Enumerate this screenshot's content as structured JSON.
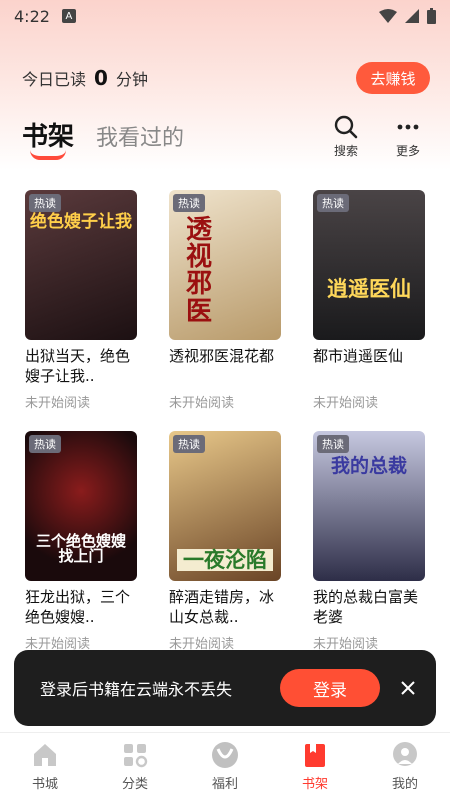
{
  "status_bar": {
    "time": "4:22",
    "notification_letter": "A"
  },
  "reading": {
    "prefix": "今日已读",
    "minutes": "0",
    "suffix": "分钟",
    "earn_label": "去赚钱"
  },
  "tabs": {
    "active": "书架",
    "inactive": "我看过的"
  },
  "actions": {
    "search_label": "搜索",
    "more_label": "更多"
  },
  "books": [
    {
      "title": "出狱当天，绝色嫂子让我..",
      "status": "未开始阅读",
      "badge": "热读",
      "cover_text": "绝色嫂子让我",
      "cover_color": "#3a2426"
    },
    {
      "title": "透视邪医混花都",
      "status": "未开始阅读",
      "badge": "热读",
      "cover_text": "透视邪医",
      "cover_color": "#d9c8a8"
    },
    {
      "title": "都市逍遥医仙",
      "status": "未开始阅读",
      "badge": "热读",
      "cover_text": "逍遥医仙",
      "cover_color": "#2e2a2c"
    },
    {
      "title": "狂龙出狱，三个绝色嫂嫂..",
      "status": "未开始阅读",
      "badge": "热读",
      "cover_text": "三个绝色嫂嫂找上门",
      "cover_color": "#2a1214"
    },
    {
      "title": "醉酒走错房，冰山女总裁..",
      "status": "未开始阅读",
      "badge": "热读",
      "cover_text": "一夜沦陷",
      "cover_color": "#5a3c24"
    },
    {
      "title": "我的总裁白富美老婆",
      "status": "未开始阅读",
      "badge": "热读",
      "cover_text": "我的总裁",
      "cover_color": "#3a3a5a"
    }
  ],
  "toast": {
    "text": "登录后书籍在云端永不丢失",
    "login_label": "登录"
  },
  "nav": [
    {
      "label": "书城",
      "icon": "home-icon"
    },
    {
      "label": "分类",
      "icon": "category-icon"
    },
    {
      "label": "福利",
      "icon": "gift-icon"
    },
    {
      "label": "书架",
      "icon": "bookshelf-icon"
    },
    {
      "label": "我的",
      "icon": "profile-icon"
    }
  ],
  "colors": {
    "accent": "#ff4f34",
    "active_nav": "#ff3b2f"
  }
}
